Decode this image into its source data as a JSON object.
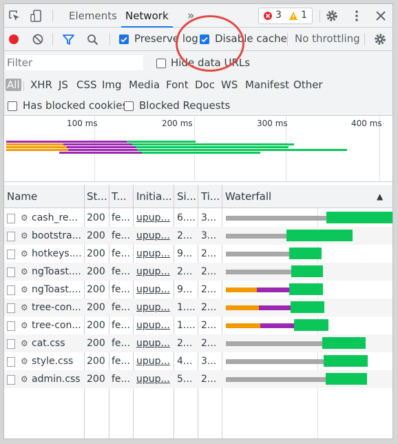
{
  "tabs": {
    "elements": "Elements",
    "network": "Network",
    "more": "»"
  },
  "badges": {
    "errors": "3",
    "warnings": "1"
  },
  "toolbar": {
    "preserve_log": "Preserve log",
    "disable_cache": "Disable cache",
    "throttling": "No throttling"
  },
  "filter": {
    "placeholder": "Filter",
    "hide_data_urls": "Hide data URLs"
  },
  "types": [
    "All",
    "XHR",
    "JS",
    "CSS",
    "Img",
    "Media",
    "Font",
    "Doc",
    "WS",
    "Manifest",
    "Other"
  ],
  "blocked": {
    "blocked_cookies": "Has blocked cookies",
    "blocked_requests": "Blocked Requests"
  },
  "overview": {
    "ticks": [
      "100 ms",
      "200 ms",
      "300 ms",
      "400 ms"
    ]
  },
  "columns": {
    "name": "Name",
    "status": "St...",
    "type": "T...",
    "initiator": "Initia...",
    "size": "Si...",
    "time": "Ti...",
    "waterfall": "Waterfall",
    "sort_arrow": "▲"
  },
  "requests": [
    {
      "name": "cash_re...",
      "status": "200",
      "type": "fe...",
      "initiator": "upup...",
      "size": "6....",
      "time": "3..."
    },
    {
      "name": "bootstra...",
      "status": "200",
      "type": "fe...",
      "initiator": "upup...",
      "size": "2...",
      "time": "3..."
    },
    {
      "name": "hotkeys....",
      "status": "200",
      "type": "fe...",
      "initiator": "upup...",
      "size": "9...",
      "time": "2..."
    },
    {
      "name": "ngToast....",
      "status": "200",
      "type": "fe...",
      "initiator": "upup...",
      "size": "2...",
      "time": "2..."
    },
    {
      "name": "ngToast....",
      "status": "200",
      "type": "fe...",
      "initiator": "upup...",
      "size": "9...",
      "time": "2..."
    },
    {
      "name": "tree-con...",
      "status": "200",
      "type": "fe...",
      "initiator": "upup...",
      "size": "1....",
      "time": "2..."
    },
    {
      "name": "tree-con...",
      "status": "200",
      "type": "fe...",
      "initiator": "upup...",
      "size": "1....",
      "time": "2..."
    },
    {
      "name": "cat.css",
      "status": "200",
      "type": "fe...",
      "initiator": "upup...",
      "size": "2...",
      "time": "2..."
    },
    {
      "name": "style.css",
      "status": "200",
      "type": "fe...",
      "initiator": "upup...",
      "size": "4...",
      "time": "3..."
    },
    {
      "name": "admin.css",
      "status": "200",
      "type": "fe...",
      "initiator": "upup...",
      "size": "5...",
      "time": "2..."
    }
  ],
  "colors": {
    "accent": "#1a73e8",
    "record": "#e8242c",
    "highlight_circle": "#e04a45",
    "wait_gray": "#a8a8a8",
    "stalled_orange": "#f29900",
    "ssl_purple": "#9c27b0",
    "download_green": "#0bc75a"
  }
}
